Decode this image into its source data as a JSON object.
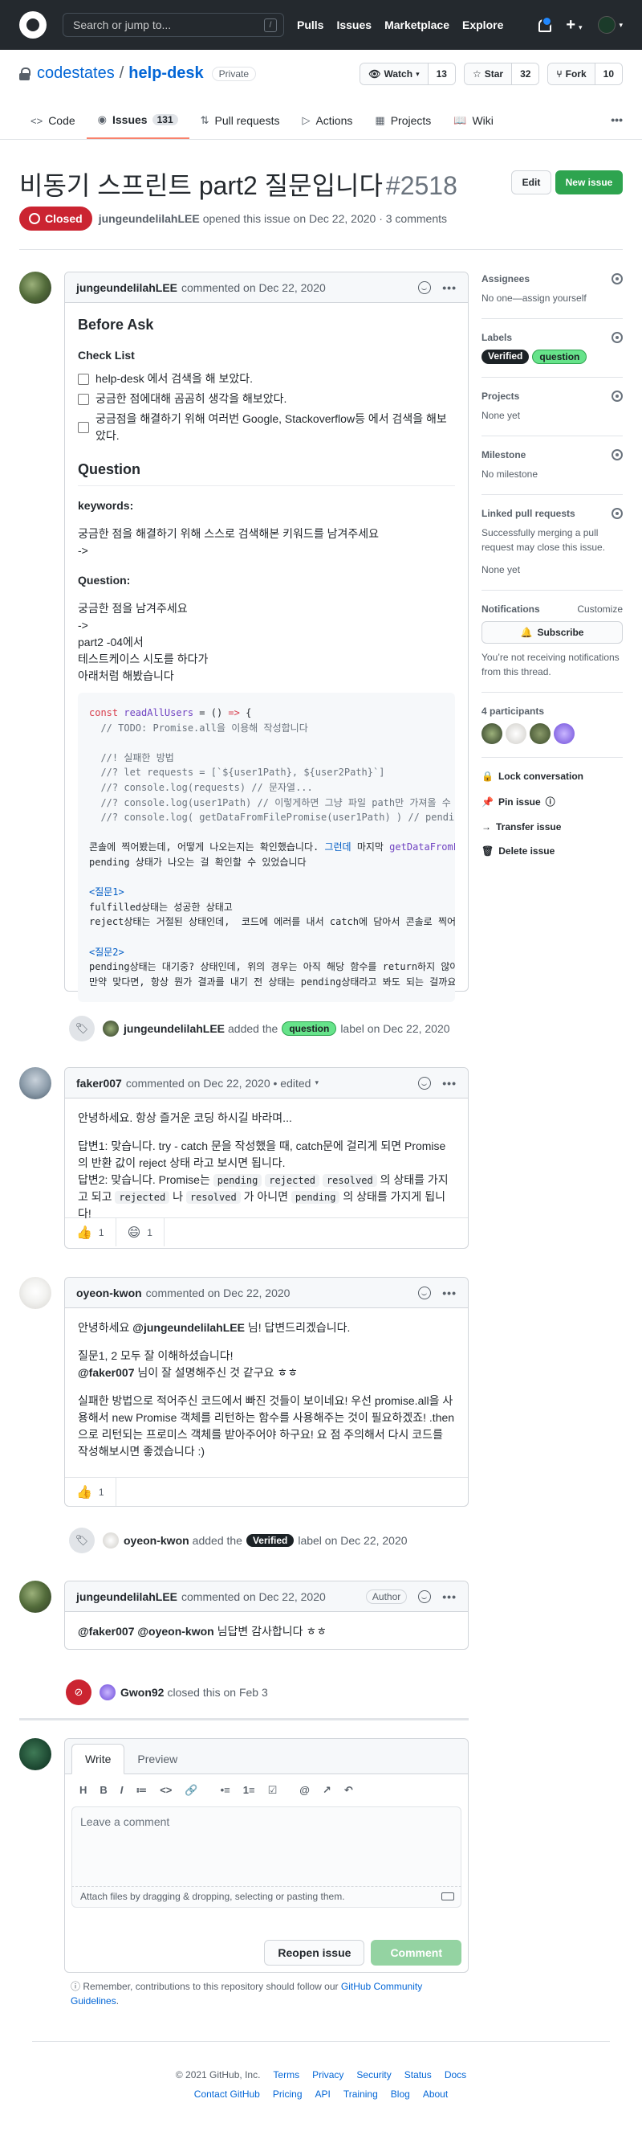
{
  "header": {
    "search_placeholder": "Search or jump to...",
    "slash_key": "/",
    "nav": [
      "Pulls",
      "Issues",
      "Marketplace",
      "Explore"
    ]
  },
  "repo": {
    "owner": "codestates",
    "separator": "/",
    "name": "help-desk",
    "visibility": "Private",
    "watch_label": "Watch",
    "watch_count": "13",
    "star_label": "Star",
    "star_count": "32",
    "fork_label": "Fork",
    "fork_count": "10",
    "tabs": [
      {
        "label": "Code",
        "icon": "code-icon"
      },
      {
        "label": "Issues",
        "icon": "issue-icon",
        "count": "131"
      },
      {
        "label": "Pull requests",
        "icon": "pull-request-icon"
      },
      {
        "label": "Actions",
        "icon": "play-icon"
      },
      {
        "label": "Projects",
        "icon": "project-icon"
      },
      {
        "label": "Wiki",
        "icon": "book-icon"
      }
    ]
  },
  "issue": {
    "title": "비동기 스프린트 part2 질문입니다",
    "number": "#2518",
    "edit_label": "Edit",
    "new_issue_label": "New issue",
    "status": "Closed",
    "author": "jungeundelilahLEE",
    "meta": "opened this issue on Dec 22, 2020 · 3 comments"
  },
  "comment1": {
    "author": "jungeundelilahLEE",
    "meta": "commented on Dec 22, 2020",
    "h_before": "Before Ask",
    "h_checklist": "Check List",
    "checks": [
      "help-desk 에서 검색을 해 보았다.",
      "궁금한 점에대해 곰곰히 생각을 해보았다.",
      "궁금점을 해결하기 위해 여러번 Google, Stackoverflow등 에서 검색을 해보았다."
    ],
    "h_question": "Question",
    "h_keywords": "keywords:",
    "keywords_text": "궁금한 점을 해결하기 위해 스스로 검색해본 키워드를 남겨주세요",
    "arrow1": "->",
    "h_question2": "Question:",
    "q_line1": "궁금한 점을 남겨주세요",
    "q_line2": "->",
    "q_line3": "part2 -04에서",
    "q_line4": "테스트케이스 시도를 하다가",
    "q_line5": "아래처럼 해봤습니다"
  },
  "event_label1": {
    "actor": "jungeundelilahLEE",
    "text1": "added the",
    "label": "question",
    "text2": "label on Dec 22, 2020"
  },
  "comment2": {
    "author": "faker007",
    "meta": "commented on Dec 22, 2020 • edited",
    "p1": "안녕하세요. 항상 즐거운 코딩 하시길 바라며...",
    "p2": "답변1: 맞습니다. try - catch 문을 작성했을 때, catch문에 걸리게 되면 Promise의 반환 값이 reject 상태 라고 보시면 됩니다.",
    "p3a": "답변2: 맞습니다. Promise는",
    "c_pending": "pending",
    "c_rejected": "rejected",
    "c_resolved": "resolved",
    "p3b": "의 상태를 가지고 되고",
    "p3c": "나",
    "p3d": "가 아니면",
    "p3e": "의 상태를 가지게 됩니다!",
    "react1": "1",
    "react2": "1"
  },
  "comment3": {
    "author": "oyeon-kwon",
    "meta": "commented on Dec 22, 2020",
    "p1a": "안녕하세요",
    "mention": "@jungeundelilahLEE",
    "p1b": "님! 답변드리겠습니다.",
    "p2": "질문1, 2 모두 잘 이해하셨습니다!",
    "mention2": "@faker007",
    "p3": "님이 잘 설명해주신 것 같구요 ㅎㅎ",
    "p4": "실패한 방법으로 적어주신 코드에서 빠진 것들이 보이네요! 우선 promise.all을 사용해서 new Promise 객체를 리턴하는 함수를 사용해주는 것이 필요하겠죠! .then으로 리턴되는 프로미스 객체를 받아주어야 하구요! 요 점 주의해서 다시 코드를 작성해보시면 좋겠습니다 :)",
    "react1": "1"
  },
  "event_label2": {
    "actor": "oyeon-kwon",
    "text1": "added the",
    "label": "Verified",
    "text2": "label on Dec 22, 2020"
  },
  "comment4": {
    "author": "jungeundelilahLEE",
    "meta": "commented on Dec 22, 2020",
    "badge": "Author",
    "m1": "@faker007",
    "m2": "@oyeon-kwon",
    "text": "님답변 감사합니다 ㅎㅎ"
  },
  "event_closed": {
    "actor": "Gwon92",
    "text": "closed this on Feb 3"
  },
  "composer": {
    "tab_write": "Write",
    "tab_preview": "Preview",
    "placeholder": "Leave a comment",
    "attach": "Attach files by dragging & dropping, selecting or pasting them.",
    "reopen": "Reopen issue",
    "comment": "Comment",
    "toolbar": [
      "H",
      "B",
      "I",
      "≔",
      "<>",
      "🔗",
      "•≡",
      "1≡",
      "☑",
      "@",
      "↗",
      "↶"
    ]
  },
  "reminder": {
    "text": "Remember, contributions to this repository should follow our",
    "link": "GitHub Community Guidelines",
    "end": "."
  },
  "sidebar": {
    "assignees_title": "Assignees",
    "assignees_value": "No one—assign yourself",
    "labels_title": "Labels",
    "label_verified": "Verified",
    "label_question": "question",
    "projects_title": "Projects",
    "projects_value": "None yet",
    "milestone_title": "Milestone",
    "milestone_value": "No milestone",
    "linked_title": "Linked pull requests",
    "linked_desc": "Successfully merging a pull request may close this issue.",
    "linked_value": "None yet",
    "notif_title": "Notifications",
    "notif_customize": "Customize",
    "subscribe": "Subscribe",
    "notif_desc": "You’re not receiving notifications from this thread.",
    "participants": "4 participants",
    "lock": "Lock conversation",
    "pin": "Pin issue",
    "transfer": "Transfer issue",
    "delete": "Delete issue"
  },
  "footer": {
    "copy": "© 2021 GitHub, Inc.",
    "row1": [
      "Terms",
      "Privacy",
      "Security",
      "Status",
      "Docs"
    ],
    "row2": [
      "Contact GitHub",
      "Pricing",
      "API",
      "Training",
      "Blog",
      "About"
    ]
  },
  "colors": {
    "closed": "#cb2431",
    "primary": "#2ea44f",
    "link": "#0366d6",
    "label_question": "#66e38a",
    "label_verified": "#1c2226"
  }
}
